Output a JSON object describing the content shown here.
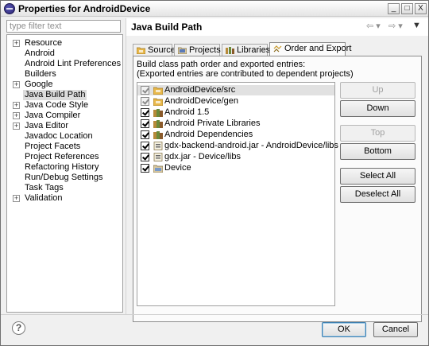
{
  "window": {
    "title": "Properties for AndroidDevice",
    "controls": {
      "minimize": "_",
      "maximize": "□",
      "close": "X"
    }
  },
  "sidebar": {
    "filter_placeholder": "type filter text",
    "items": [
      {
        "label": "Resource",
        "expandable": true,
        "selected": false
      },
      {
        "label": "Android",
        "expandable": false,
        "selected": false
      },
      {
        "label": "Android Lint Preferences",
        "expandable": false,
        "selected": false
      },
      {
        "label": "Builders",
        "expandable": false,
        "selected": false
      },
      {
        "label": "Google",
        "expandable": true,
        "selected": false
      },
      {
        "label": "Java Build Path",
        "expandable": false,
        "selected": true
      },
      {
        "label": "Java Code Style",
        "expandable": true,
        "selected": false
      },
      {
        "label": "Java Compiler",
        "expandable": true,
        "selected": false
      },
      {
        "label": "Java Editor",
        "expandable": true,
        "selected": false
      },
      {
        "label": "Javadoc Location",
        "expandable": false,
        "selected": false
      },
      {
        "label": "Project Facets",
        "expandable": false,
        "selected": false
      },
      {
        "label": "Project References",
        "expandable": false,
        "selected": false
      },
      {
        "label": "Refactoring History",
        "expandable": false,
        "selected": false
      },
      {
        "label": "Run/Debug Settings",
        "expandable": false,
        "selected": false
      },
      {
        "label": "Task Tags",
        "expandable": false,
        "selected": false
      },
      {
        "label": "Validation",
        "expandable": true,
        "selected": false
      }
    ]
  },
  "main": {
    "title": "Java Build Path",
    "tabs": [
      {
        "label": "Source",
        "icon": "source-folder-icon",
        "active": false
      },
      {
        "label": "Projects",
        "icon": "projects-icon",
        "active": false
      },
      {
        "label": "Libraries",
        "icon": "libraries-icon",
        "active": false
      },
      {
        "label": "Order and Export",
        "icon": "order-export-icon",
        "active": true
      }
    ],
    "description_line1": "Build class path order and exported entries:",
    "description_line2": "(Exported entries are contributed to dependent projects)",
    "entries": [
      {
        "label": "AndroidDevice/src",
        "checked": true,
        "disabled": true,
        "selected": true,
        "icon": "source-folder-icon"
      },
      {
        "label": "AndroidDevice/gen",
        "checked": true,
        "disabled": true,
        "selected": false,
        "icon": "source-folder-icon"
      },
      {
        "label": "Android 1.5",
        "checked": true,
        "disabled": false,
        "selected": false,
        "icon": "library-icon"
      },
      {
        "label": "Android Private Libraries",
        "checked": true,
        "disabled": false,
        "selected": false,
        "icon": "library-icon"
      },
      {
        "label": "Android Dependencies",
        "checked": true,
        "disabled": false,
        "selected": false,
        "icon": "library-icon"
      },
      {
        "label": "gdx-backend-android.jar - AndroidDevice/libs",
        "checked": true,
        "disabled": false,
        "selected": false,
        "icon": "jar-icon"
      },
      {
        "label": "gdx.jar - Device/libs",
        "checked": true,
        "disabled": false,
        "selected": false,
        "icon": "jar-icon"
      },
      {
        "label": "Device",
        "checked": true,
        "disabled": false,
        "selected": false,
        "icon": "project-icon"
      }
    ],
    "buttons": {
      "up": "Up",
      "down": "Down",
      "top": "Top",
      "bottom": "Bottom",
      "select_all": "Select All",
      "deselect_all": "Deselect All"
    }
  },
  "footer": {
    "help": "?",
    "ok": "OK",
    "cancel": "Cancel"
  },
  "colors": {
    "selection": "#dcdcdc",
    "folder": "#e8b84a",
    "library": "#b78a3a"
  }
}
